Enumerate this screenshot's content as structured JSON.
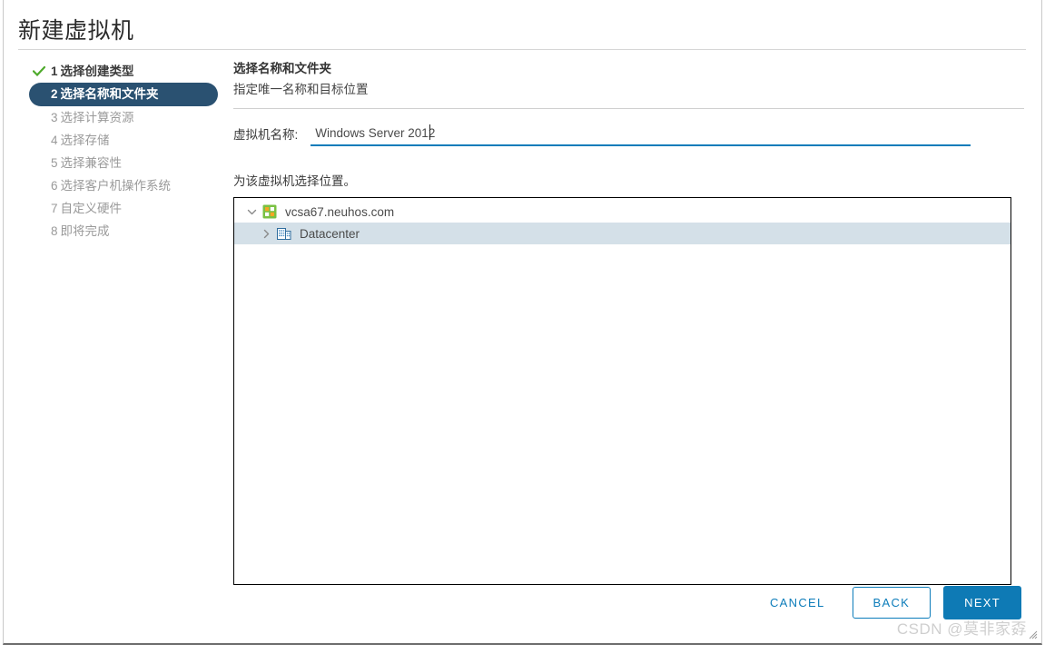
{
  "window": {
    "title": "新建虚拟机"
  },
  "sidebar": {
    "steps": [
      {
        "num": "1",
        "label": "选择创建类型",
        "state": "done"
      },
      {
        "num": "2",
        "label": "选择名称和文件夹",
        "state": "active"
      },
      {
        "num": "3",
        "label": "选择计算资源",
        "state": "pending"
      },
      {
        "num": "4",
        "label": "选择存储",
        "state": "pending"
      },
      {
        "num": "5",
        "label": "选择兼容性",
        "state": "pending"
      },
      {
        "num": "6",
        "label": "选择客户机操作系统",
        "state": "pending"
      },
      {
        "num": "7",
        "label": "自定义硬件",
        "state": "pending"
      },
      {
        "num": "8",
        "label": "即将完成",
        "state": "pending"
      }
    ]
  },
  "main": {
    "heading": "选择名称和文件夹",
    "subheading": "指定唯一名称和目标位置",
    "name_field": {
      "label": "虚拟机名称:",
      "value": "Windows Server 2012",
      "placeholder": ""
    },
    "location_label": "为该虚拟机选择位置。",
    "tree": [
      {
        "label": "vcsa67.neuhos.com",
        "icon": "vcenter-icon",
        "expanded": true,
        "selected": false,
        "level": 0
      },
      {
        "label": "Datacenter",
        "icon": "datacenter-icon",
        "expanded": false,
        "selected": true,
        "level": 1
      }
    ]
  },
  "footer": {
    "cancel_label": "CANCEL",
    "back_label": "BACK",
    "next_label": "NEXT"
  },
  "watermark": {
    "text": "CSDN @莫非家孬"
  },
  "colors": {
    "accent": "#0c7cba",
    "active_step_bg": "#2a5171",
    "check_green": "#4eaa2b",
    "selected_row": "#d4e0e8",
    "next_button": "#0e7ab5"
  }
}
